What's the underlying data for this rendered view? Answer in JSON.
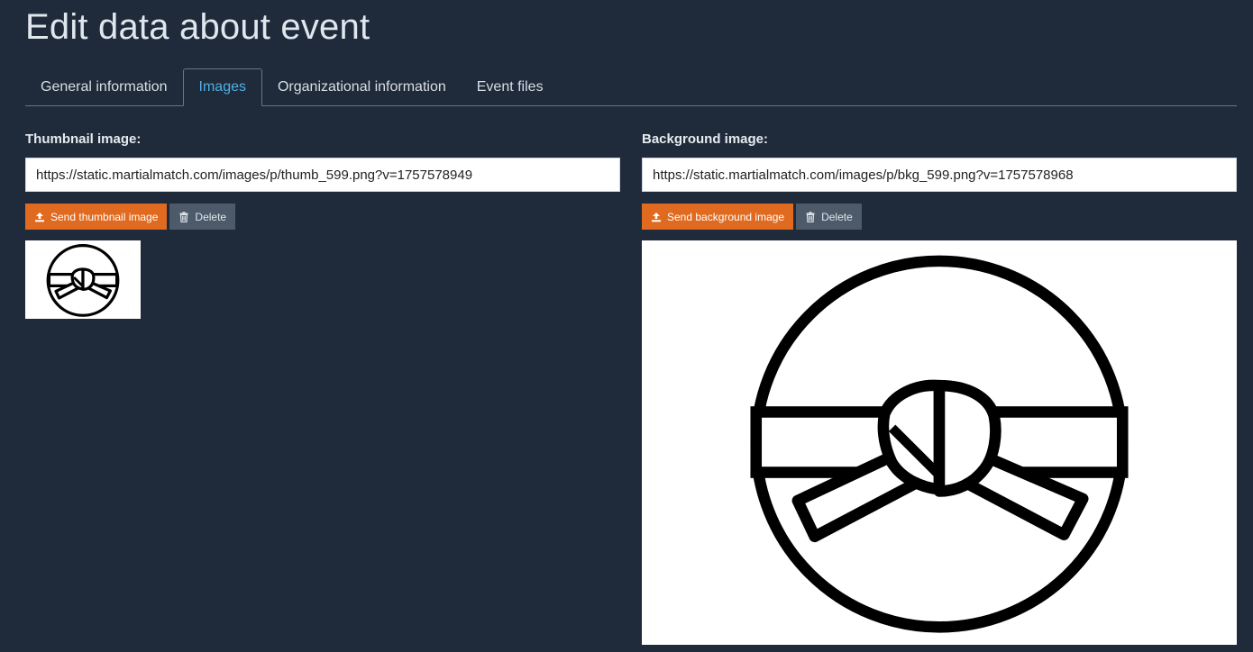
{
  "page": {
    "title": "Edit data about event"
  },
  "tabs": [
    {
      "label": "General information",
      "active": false
    },
    {
      "label": "Images",
      "active": true
    },
    {
      "label": "Organizational information",
      "active": false
    },
    {
      "label": "Event files",
      "active": false
    }
  ],
  "thumbnail": {
    "label": "Thumbnail image:",
    "url": "https://static.martialmatch.com/images/p/thumb_599.png?v=1757578949",
    "send_label": "Send thumbnail image",
    "delete_label": "Delete"
  },
  "background": {
    "label": "Background image:",
    "url": "https://static.martialmatch.com/images/p/bkg_599.png?v=1757578968",
    "send_label": "Send background image",
    "delete_label": "Delete"
  },
  "icons": {
    "upload": "upload-icon",
    "delete": "trash-icon",
    "image": "martial-arts-belt-icon"
  },
  "colors": {
    "background": "#1f2b3a",
    "accent_tab": "#4fb0e6",
    "send_button": "#e06a1f",
    "delete_button": "#4c5a69"
  }
}
